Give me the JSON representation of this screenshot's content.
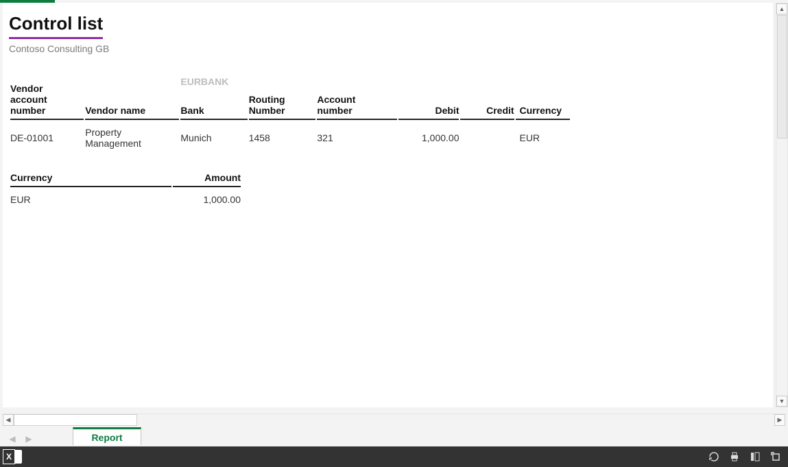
{
  "report_title": "Control list",
  "subtitle": "Contoso Consulting GB",
  "main_table": {
    "headers": {
      "vendor_acct": "Vendor\naccount\nnumber",
      "vendor_name": "Vendor name",
      "bank": "Bank",
      "routing": "Routing\nNumber",
      "account_no": "Account\nnumber",
      "debit": "Debit",
      "credit": "Credit",
      "currency": "Currency"
    },
    "bank_ghost": "EURBANK",
    "rows": [
      {
        "vendor_acct": "DE-01001",
        "vendor_name": "Property Management",
        "bank": "Munich",
        "routing": "1458",
        "account_no": "321",
        "debit": "1,000.00",
        "credit": "",
        "currency": "EUR"
      }
    ]
  },
  "summary_table": {
    "headers": {
      "currency": "Currency",
      "amount": "Amount"
    },
    "rows": [
      {
        "currency": "EUR",
        "amount": "1,000.00"
      }
    ]
  },
  "tab_label": "Report"
}
